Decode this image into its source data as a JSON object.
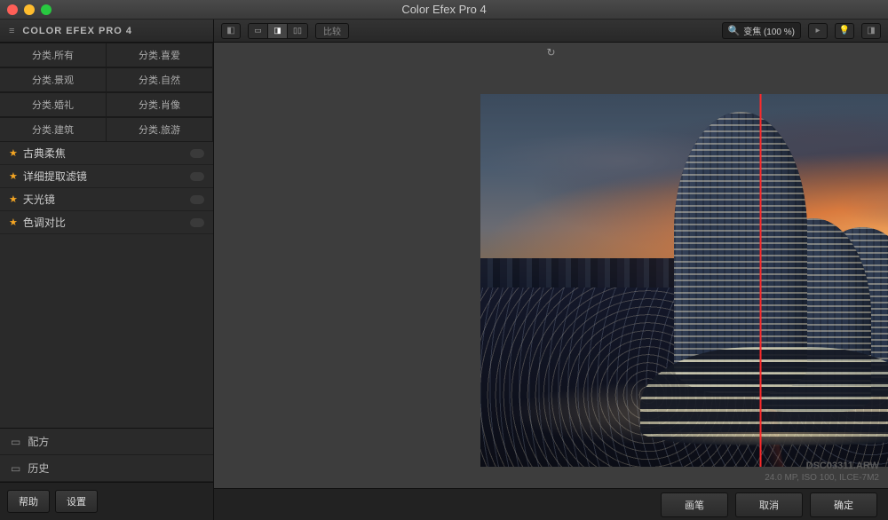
{
  "window": {
    "title": "Color Efex Pro 4"
  },
  "sidebar": {
    "header": "COLOR EFEX PRO 4",
    "categories": [
      "分类.所有",
      "分类.喜爱",
      "分类.景观",
      "分类.自然",
      "分类.婚礼",
      "分类.肖像",
      "分类.建筑",
      "分类.旅游"
    ],
    "filters": [
      {
        "label": "古典柔焦"
      },
      {
        "label": "详细提取滤镜"
      },
      {
        "label": "天光镜"
      },
      {
        "label": "色调对比"
      }
    ],
    "recipe": "配方",
    "history": "历史",
    "help": "帮助",
    "settings": "设置"
  },
  "toolbar": {
    "compare": "比较",
    "zoom_label": "变焦 (100 %)"
  },
  "image": {
    "filename": "DSC03311.ARW",
    "info": "24.0 MP, ISO 100, ILCE-7M2"
  },
  "actions": {
    "brush": "画笔",
    "cancel": "取消",
    "ok": "确定"
  }
}
